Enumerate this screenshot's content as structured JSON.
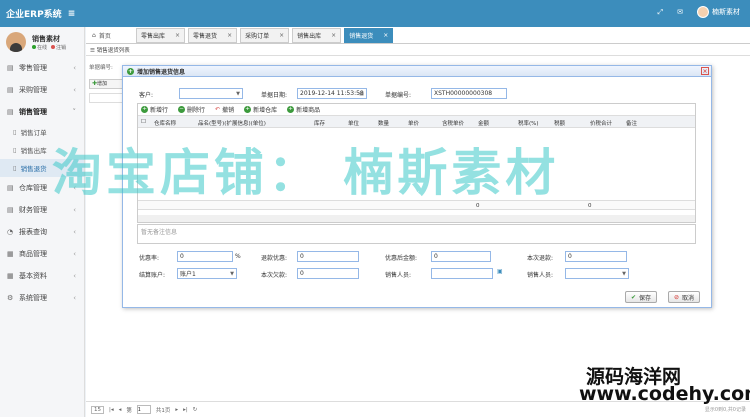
{
  "app": {
    "title": "企业ERP系统"
  },
  "topbar": {
    "username": "楠斯素材"
  },
  "user": {
    "name": "销售素材",
    "status": "在线",
    "logout": "注销"
  },
  "sidebar": {
    "items": [
      {
        "label": "零售管理"
      },
      {
        "label": "采购管理"
      },
      {
        "label": "销售管理"
      },
      {
        "label": "仓库管理"
      },
      {
        "label": "财务管理"
      },
      {
        "label": "报表查询"
      },
      {
        "label": "商品管理"
      },
      {
        "label": "基本资料"
      },
      {
        "label": "系统管理"
      }
    ],
    "sub": [
      {
        "label": "销售订单"
      },
      {
        "label": "销售出库"
      },
      {
        "label": "销售退货"
      }
    ]
  },
  "tabs": {
    "home": "首页",
    "items": [
      {
        "label": "零售出库"
      },
      {
        "label": "零售退货"
      },
      {
        "label": "采购订单"
      },
      {
        "label": "销售出库"
      },
      {
        "label": "销售退货"
      }
    ]
  },
  "panel": {
    "title": "销售退货列表",
    "search_label": "单据编号:",
    "toolbar_add": "增加"
  },
  "dialog": {
    "title": "增加销售退货信息",
    "customer_label": "客户:",
    "customer_value": "",
    "date_label": "单据日期:",
    "date_value": "2019-12-14 11:53:58",
    "number_label": "单据编号:",
    "number_value": "XSTH00000000308",
    "toolbar": [
      {
        "label": "新增行"
      },
      {
        "label": "删除行"
      },
      {
        "label": "撤销"
      },
      {
        "label": "新增仓库"
      },
      {
        "label": "新增商品"
      }
    ],
    "columns": [
      "仓库名称",
      "品名(型号)(扩展信息)(单位)",
      "库存",
      "单位",
      "数量",
      "单价",
      "含税单价",
      "金额",
      "税率(%)",
      "税额",
      "价税合计",
      "备注"
    ],
    "totals": {
      "amount": "0",
      "tax_total": "0"
    },
    "remark_placeholder": "暂无备注信息",
    "discount_rate_label": "优惠率:",
    "discount_rate_value": "0",
    "discount_rate_unit": "%",
    "refund_discount_label": "退款优惠:",
    "refund_discount_value": "0",
    "after_discount_label": "优惠后金额:",
    "after_discount_value": "0",
    "this_refund_label": "本次退款:",
    "this_refund_value": "0",
    "account_label": "结算账户:",
    "account_value": "账户1",
    "this_debt_label": "本次欠款:",
    "this_debt_value": "0",
    "sales_person_label": "销售人员:",
    "salesman_label": "销售人员:",
    "save": "保存",
    "cancel": "取消"
  },
  "pager": {
    "page_size": "15",
    "page_label": "第",
    "page_value": "1",
    "total_pages": "共1页",
    "info": "显示0到0,共0记录"
  },
  "watermark": {
    "main": "淘宝店铺： 楠斯素材",
    "site_cn": "源码海洋网",
    "site_url": "www.codehy.com"
  }
}
